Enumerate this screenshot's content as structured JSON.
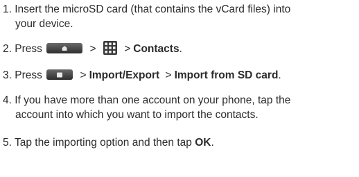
{
  "steps": [
    {
      "number": "1.",
      "line1": "Insert the microSD card (that contains the vCard files) into",
      "line2": "your device."
    },
    {
      "number": "2.",
      "press": "Press",
      "sep1": ">",
      "sep2": ">",
      "target": "Contacts",
      "end": ".",
      "home_key_icon": "home-key-icon",
      "apps_icon": "applications-grid-icon"
    },
    {
      "number": "3.",
      "press": "Press",
      "sep1": ">",
      "part1": "Import/Export",
      "sep2": ">",
      "part2": "Import from SD card",
      "end": ".",
      "menu_key_icon": "menu-key-icon"
    },
    {
      "number": "4.",
      "line1": "If you have more than one account on your phone, tap the",
      "line2": "account into which you want to import the contacts."
    },
    {
      "number": "5.",
      "text": "Tap the importing option and then tap",
      "bold": "OK",
      "end": "."
    }
  ]
}
